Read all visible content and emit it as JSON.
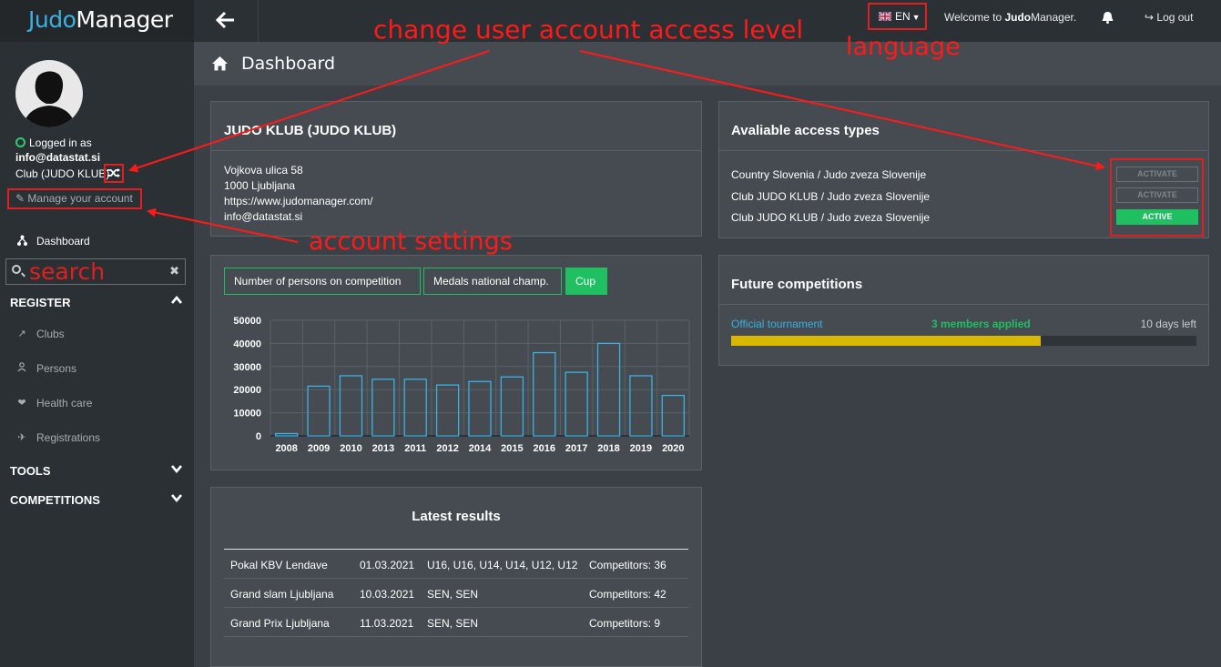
{
  "brand": {
    "part1": "Judo",
    "part2": "Manager"
  },
  "user": {
    "logged_in_label": "Logged in as",
    "email": "info@datastat.si",
    "role": "Club (JUDO KLUB)",
    "manage_label": "Manage your account"
  },
  "sidebar": {
    "dashboard": "Dashboard",
    "search_placeholder": "search",
    "register": {
      "title": "REGISTER",
      "items": [
        "Clubs",
        "Persons",
        "Health care",
        "Registrations"
      ]
    },
    "tools": "TOOLS",
    "competitions": "COMPETITIONS"
  },
  "topbar": {
    "language": "EN",
    "welcome_prefix": "Welcome to ",
    "welcome_brand": "Judo",
    "welcome_suffix": "Manager.",
    "logout": "Log out"
  },
  "page": {
    "title": "Dashboard"
  },
  "club": {
    "title": "JUDO KLUB (JUDO KLUB)",
    "address": "Vojkova ulica 58",
    "city": "1000 Ljubljana",
    "website": "https://www.judomanager.com/",
    "email": "info@datastat.si"
  },
  "chart_tabs": [
    "Number of persons on competition",
    "Medals national champ.",
    "Cup"
  ],
  "chart_data": {
    "type": "bar",
    "categories": [
      "2008",
      "2009",
      "2010",
      "2013",
      "2011",
      "2012",
      "2014",
      "2015",
      "2016",
      "2017",
      "2018",
      "2019",
      "2020"
    ],
    "values": [
      1000,
      21500,
      26000,
      24500,
      24500,
      22000,
      23500,
      25500,
      36000,
      27500,
      40000,
      26000,
      17500
    ],
    "ylim": [
      0,
      50000
    ],
    "yticks": [
      0,
      10000,
      20000,
      30000,
      40000,
      50000
    ],
    "grid": true,
    "bar_color": "#3ab1e2"
  },
  "results": {
    "title": "Latest results",
    "rows": [
      {
        "name": "Pokal KBV Lendave",
        "date": "01.03.2021",
        "categories": "U16, U16, U14, U14, U12, U12",
        "competitors": "Competitors: 36"
      },
      {
        "name": "Grand slam Ljubljana",
        "date": "10.03.2021",
        "categories": "SEN, SEN",
        "competitors": "Competitors: 42"
      },
      {
        "name": "Grand Prix Ljubljana",
        "date": "11.03.2021",
        "categories": "SEN, SEN",
        "competitors": "Competitors: 9"
      }
    ]
  },
  "access": {
    "title": "Avaliable access types",
    "items": [
      {
        "label": "Country Slovenia / Judo zveza Slovenije",
        "status": "ACTIVATE"
      },
      {
        "label": "Club JUDO KLUB / Judo zveza Slovenije",
        "status": "ACTIVATE"
      },
      {
        "label": "Club JUDO KLUB / Judo zveza Slovenije",
        "status": "ACTIVE"
      }
    ]
  },
  "future": {
    "title": "Future competitions",
    "name": "Official tournament",
    "applied": "3 members applied",
    "days_left": "10 days left",
    "progress_fraction": 0.665
  },
  "annotations": {
    "access_level": "change user account access level",
    "language": "language",
    "account_settings": "account settings",
    "search": "search"
  },
  "colors": {
    "accent": "#3ab1e2",
    "green": "#1fbf62",
    "annotation": "#e02020",
    "progress": "#d9b800"
  }
}
